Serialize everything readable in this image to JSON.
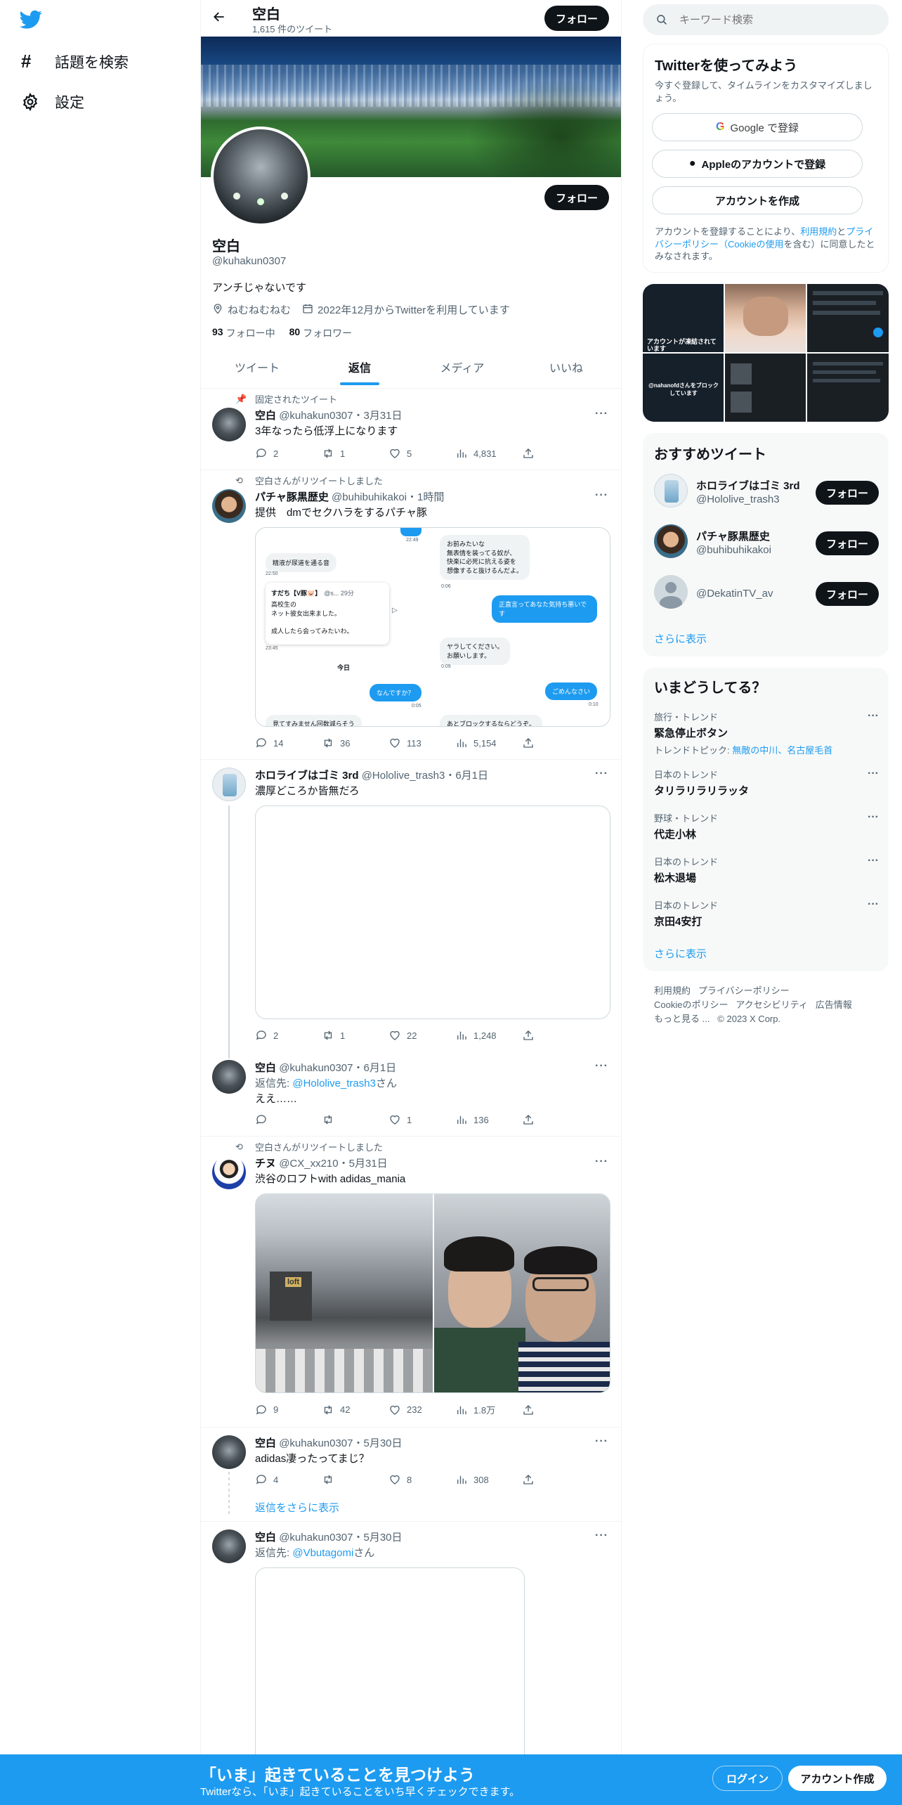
{
  "nav": {
    "explore_label": "話題を検索",
    "settings_label": "設定"
  },
  "header": {
    "name": "空白",
    "tweet_count": "1,615 件のツイート",
    "follow_label": "フォロー"
  },
  "profile": {
    "name": "空白",
    "handle": "@kuhakun0307",
    "bio": "アンチじゃないです",
    "location": "ねむねむねむ",
    "joined": "2022年12月からTwitterを利用しています",
    "following_count": "93",
    "following_label": "フォロー中",
    "followers_count": "80",
    "followers_label": "フォロワー",
    "follow_label": "フォロー"
  },
  "tabs": [
    {
      "label": "ツイート"
    },
    {
      "label": "返信"
    },
    {
      "label": "メディア"
    },
    {
      "label": "いいね"
    }
  ],
  "tweets": [
    {
      "social": "固定されたツイート",
      "name": "空白",
      "handle": "@kuhakun0307",
      "time": "・3月31日",
      "text": "3年なったら低浮上になります",
      "reply": "2",
      "retweet": "1",
      "like": "5",
      "views": "4,831"
    },
    {
      "social": "空白さんがリツイートしました",
      "name": "パチャ豚黒歴史",
      "handle": "@buhibuhikakoi",
      "time": "・1時間",
      "text": "提供　dmでセクハラをするパチャ豚",
      "reply": "14",
      "retweet": "36",
      "like": "113",
      "views": "5,154",
      "chat": {
        "b1": "精液が尿道を通る音",
        "t1": "22:50",
        "b2": "お前みたいな\n無表情を装ってる奴が、\n快楽に必死に抗える姿を\n想像すると抜けるんだよ。",
        "t2": "0:06",
        "card_name": "すだち【V豚🐷】",
        "card_handle": "@s... 29分",
        "card_text": "高校生の\nネット彼女出来ました。\n\n成人したら会ってみたいわ。",
        "t3": "23:45",
        "b3": "正直言ってあなた気持ち悪いです",
        "b4": "ヤラしてください。\nお願いします。",
        "t4": "0:09",
        "today": "今日",
        "b5": "なんですか？",
        "t5": "0:05",
        "b6": "ごめんなさい",
        "t6": "0:10",
        "b7": "見てすみません回数減らそう",
        "b8": "あとブロックするならどうぞ。"
      }
    },
    {
      "name": "ホロライブはゴミ 3rd",
      "handle": "@Hololive_trash3",
      "time": "・6月1日",
      "text": "濃厚どころか皆無だろ",
      "reply": "2",
      "retweet": "1",
      "like": "22",
      "views": "1,248"
    },
    {
      "name": "空白",
      "handle": "@kuhakun0307",
      "time": "・6月1日",
      "reply_to_prefix": "返信先: ",
      "reply_to": "@Hololive_trash3",
      "reply_to_suffix": "さん",
      "text": "ええ……",
      "reply": "",
      "retweet": "",
      "like": "1",
      "views": "136"
    },
    {
      "social": "空白さんがリツイートしました",
      "name": "チヌ",
      "handle": "@CX_xx210",
      "time": "・5月31日",
      "text": "渋谷のロフトwith adidas_mania",
      "reply": "9",
      "retweet": "42",
      "like": "232",
      "views": "1.8万",
      "photo_sign": "loft"
    },
    {
      "name": "空白",
      "handle": "@kuhakun0307",
      "time": "・5月30日",
      "text": "adidas凄ったってまじ？",
      "reply": "4",
      "retweet": "",
      "like": "8",
      "views": "308",
      "show_more": "返信をさらに表示"
    },
    {
      "name": "空白",
      "handle": "@kuhakun0307",
      "time": "・5月30日",
      "reply_to_prefix": "返信先: ",
      "reply_to": "@Vbutagomi",
      "reply_to_suffix": "さん"
    }
  ],
  "right": {
    "search_placeholder": "キーワード検索",
    "signup": {
      "title": "Twitterを使ってみよう",
      "sub": "今すぐ登録して、タイムラインをカスタマイズしましょう。",
      "google": "Google で登録",
      "apple": "Appleのアカウントで登録",
      "create": "アカウントを作成",
      "terms_a": "アカウントを登録することにより、",
      "terms_link1": "利用規約",
      "terms_b": "と",
      "terms_link2": "プライバシーポリシー（Cookieの使用",
      "terms_c": "を含む）に同意したとみなされます。"
    },
    "media_tiles": [
      {
        "caption": "アカウントが凍結されています"
      },
      {
        "caption": ""
      },
      {
        "caption": ""
      },
      {
        "caption": "@nahanofdさんをブロックしています"
      },
      {
        "caption": ""
      },
      {
        "caption": ""
      }
    ],
    "recommend": {
      "title": "おすすめツイート",
      "users": [
        {
          "name": "ホロライブはゴミ 3rd",
          "handle": "@Hololive_trash3",
          "btn": "フォロー"
        },
        {
          "name": "パチャ豚黒歴史",
          "handle": "@buhibuhikakoi",
          "btn": "フォロー"
        },
        {
          "name": "",
          "handle": "@DekatinTV_av",
          "btn": "フォロー"
        }
      ],
      "more": "さらに表示"
    },
    "trends": {
      "title": "いまどうしてる？",
      "items": [
        {
          "cat": "旅行・トレンド",
          "title": "緊急停止ボタン",
          "extra_prefix": "トレンドトピック: ",
          "extra_link": "無敵の中川、名古屋毛首"
        },
        {
          "cat": "日本のトレンド",
          "title": "タリラリラリラッタ"
        },
        {
          "cat": "野球・トレンド",
          "title": "代走小林"
        },
        {
          "cat": "日本のトレンド",
          "title": "松木退場"
        },
        {
          "cat": "日本のトレンド",
          "title": "京田4安打"
        }
      ],
      "more": "さらに表示"
    },
    "footer": {
      "l1": "利用規約",
      "l2": "プライバシーポリシー",
      "l3": "Cookieのポリシー",
      "l4": "アクセシビリティ",
      "l5": "広告情報",
      "l6": "もっと見る ...",
      "l7": "© 2023 X Corp."
    }
  },
  "bottom": {
    "title": "「いま」起きていることを見つけよう",
    "sub": "Twitterなら、「いま」起きていることをいち早くチェックできます。",
    "login": "ログイン",
    "signup": "アカウント作成"
  },
  "colors": {
    "accent": "#1d9bf0",
    "text": "#0f1419",
    "muted": "#536471"
  }
}
